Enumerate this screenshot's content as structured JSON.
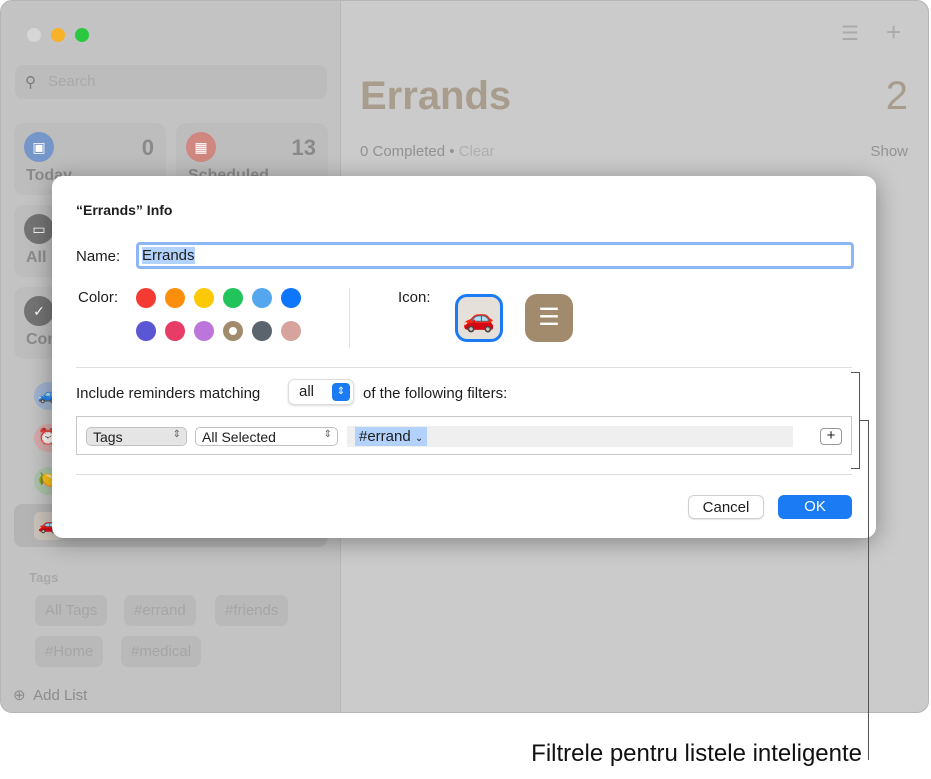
{
  "window": {
    "traffic_lights": [
      "#d6d6d6",
      "#f7b228",
      "#2ac840"
    ]
  },
  "sidebar": {
    "search_placeholder": "Search",
    "cards": [
      {
        "label": "Today",
        "count": "0",
        "color": "#7596c8",
        "icon": "calendar-icon"
      },
      {
        "label": "Scheduled",
        "count": "13",
        "color": "#d08780",
        "icon": "calendar-grid-icon"
      },
      {
        "label": "All",
        "icon": "tray-icon"
      },
      {
        "label": "Completed",
        "icon": "checkmark-icon"
      }
    ],
    "tags_header": "Tags",
    "tags": [
      "All Tags",
      "#errand",
      "#friends",
      "#Home",
      "#medical"
    ],
    "add_list": "Add List"
  },
  "main": {
    "title": "Errands",
    "count": "2",
    "completed": "0 Completed",
    "separator": "•",
    "clear": "Clear",
    "show": "Show",
    "accent": "#a89d8d"
  },
  "dialog": {
    "title": "“Errands” Info",
    "name_label": "Name:",
    "name_value": "Errands",
    "color_label": "Color:",
    "colors": [
      "#f43b33",
      "#fb8e0b",
      "#fdc906",
      "#20c45a",
      "#54a7ef",
      "#0e76fb",
      "#5b56d4",
      "#e63c66",
      "#bc75da",
      "#a28a6c",
      "#5b636c",
      "#d6a49d"
    ],
    "selected_color": "#a28a6c",
    "icon_label": "Icon:",
    "icons": [
      "car-emoji",
      "list-bullet-icon"
    ],
    "selected_icon": "car-emoji",
    "include_prefix": "Include reminders matching",
    "match_value": "all",
    "include_suffix": "of the following filters:",
    "filter": {
      "field": "Tags",
      "mode": "All Selected",
      "token": "#errand"
    },
    "cancel": "Cancel",
    "ok": "OK"
  },
  "annotation": "Filtrele pentru listele inteligente"
}
